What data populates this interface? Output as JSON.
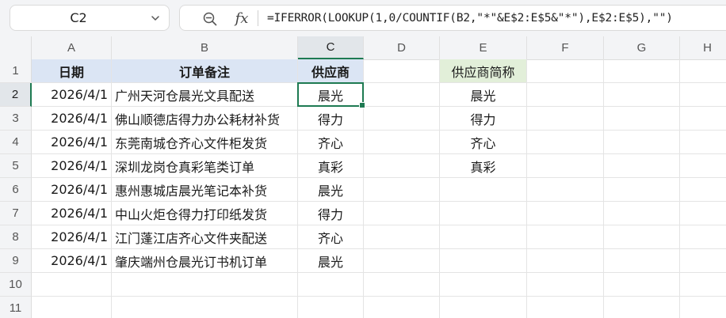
{
  "name_box": {
    "value": "C2"
  },
  "formula_bar": {
    "zoom_icon": "zoom-search-icon",
    "fx_label": "fx",
    "formula": "=IFERROR(LOOKUP(1,0/COUNTIF(B2,\"*\"&E$2:E$5&\"*\"),E$2:E$5),\"\")"
  },
  "columns": [
    "A",
    "B",
    "C",
    "D",
    "E",
    "F",
    "G",
    "H"
  ],
  "rows": [
    "1",
    "2",
    "3",
    "4",
    "5",
    "6",
    "7",
    "8",
    "9",
    "10",
    "11"
  ],
  "selected": {
    "cell": "C2",
    "column": "C",
    "row": "2"
  },
  "table": {
    "headers": {
      "date": "日期",
      "note": "订单备注",
      "supplier": "供应商"
    },
    "rows": [
      {
        "date": "2026/4/1",
        "note": "广州天河仓晨光文具配送",
        "supplier": "晨光"
      },
      {
        "date": "2026/4/1",
        "note": "佛山顺德店得力办公耗材补货",
        "supplier": "得力"
      },
      {
        "date": "2026/4/1",
        "note": "东莞南城仓齐心文件柜发货",
        "supplier": "齐心"
      },
      {
        "date": "2026/4/1",
        "note": "深圳龙岗仓真彩笔类订单",
        "supplier": "真彩"
      },
      {
        "date": "2026/4/1",
        "note": "惠州惠城店晨光笔记本补货",
        "supplier": "晨光"
      },
      {
        "date": "2026/4/1",
        "note": "中山火炬仓得力打印纸发货",
        "supplier": "得力"
      },
      {
        "date": "2026/4/1",
        "note": "江门蓬江店齐心文件夹配送",
        "supplier": "齐心"
      },
      {
        "date": "2026/4/1",
        "note": "肇庆端州仓晨光订书机订单",
        "supplier": "晨光"
      }
    ]
  },
  "lookup": {
    "header": "供应商简称",
    "values": [
      "晨光",
      "得力",
      "齐心",
      "真彩"
    ]
  },
  "colors": {
    "header_blue": "#dbe5f4",
    "header_green": "#e2efd9",
    "selection": "#1e7a52"
  }
}
